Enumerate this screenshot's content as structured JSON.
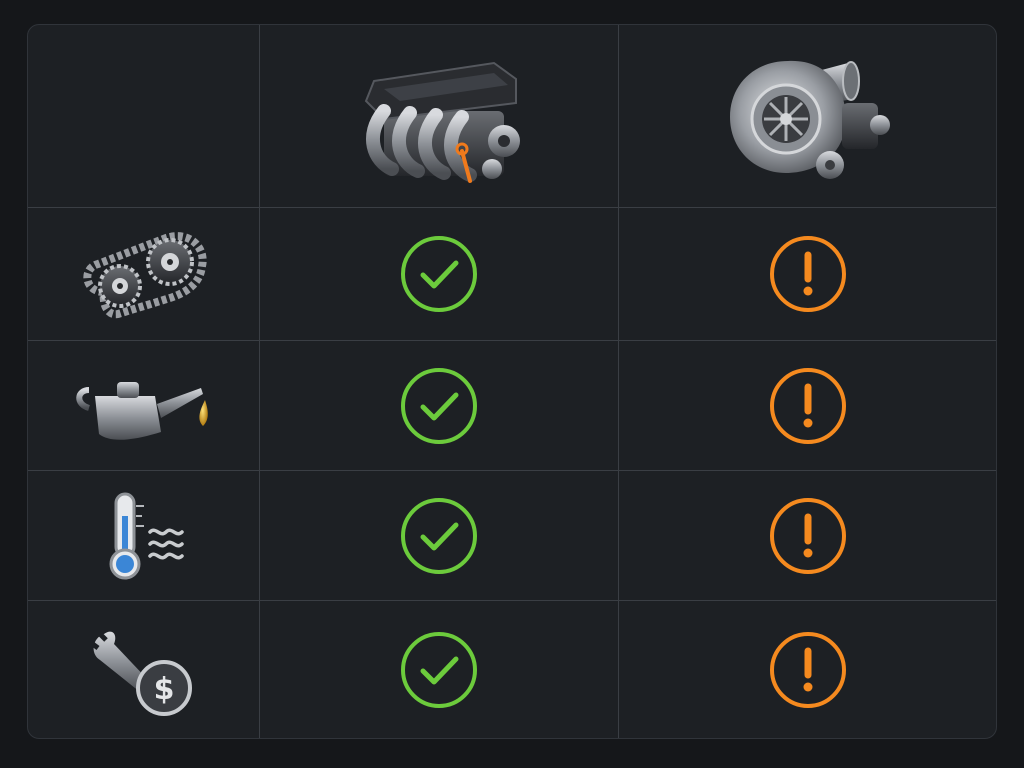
{
  "colors": {
    "background": "#15171a",
    "panel": "#1d2024",
    "grid_line": "#3a3e44",
    "check": "#6ccb3c",
    "warning": "#f58a1f"
  },
  "columns": [
    {
      "id": "naturally-aspirated",
      "icon": "engine-icon"
    },
    {
      "id": "turbocharged",
      "icon": "turbocharger-icon"
    }
  ],
  "rows": [
    {
      "id": "timing-chain",
      "icon": "timing-chain-gears-icon",
      "cells": [
        "check-icon",
        "warning-icon"
      ]
    },
    {
      "id": "oil",
      "icon": "oil-can-icon",
      "cells": [
        "check-icon",
        "warning-icon"
      ]
    },
    {
      "id": "heat",
      "icon": "thermometer-heat-icon",
      "cells": [
        "check-icon",
        "warning-icon"
      ]
    },
    {
      "id": "maintenance-cost",
      "icon": "wrench-dollar-icon",
      "cells": [
        "check-icon",
        "warning-icon"
      ]
    }
  ]
}
